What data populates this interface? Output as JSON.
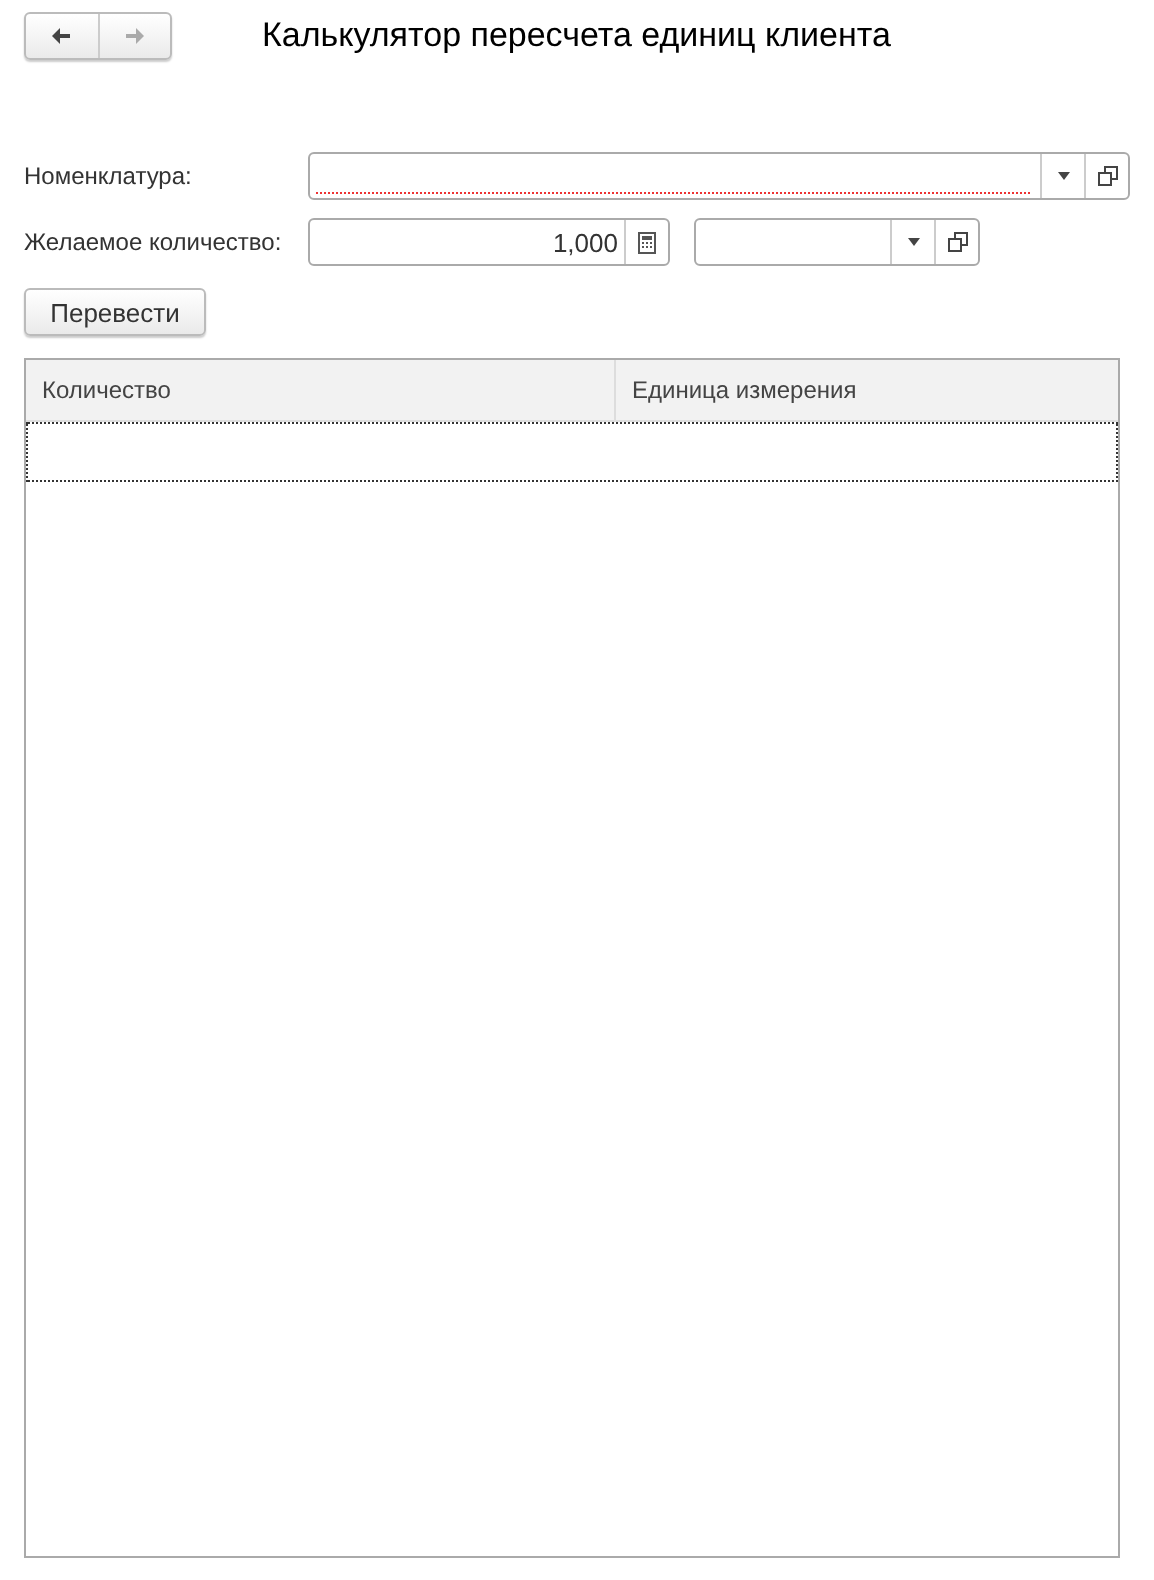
{
  "navigation": {
    "back": {
      "disabled": false
    },
    "forward": {
      "disabled": true
    }
  },
  "title": "Калькулятор пересчета единиц клиента",
  "fields": [
    {
      "kind": "choice",
      "label": "Номенклатура:",
      "required": true
    },
    {
      "kind": "number",
      "label": "Желаемое количество:",
      "value": "1,000",
      "unit_field": {
        "kind": "choice"
      }
    }
  ],
  "convert_button": "Перевести",
  "table": {
    "columns": [
      "Количество",
      "Единица измерения"
    ],
    "current_row_focused": true
  }
}
